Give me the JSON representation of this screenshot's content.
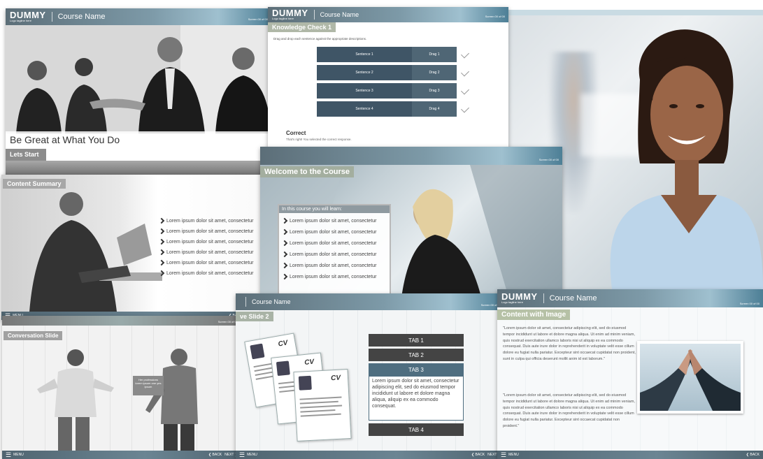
{
  "brand": {
    "logo": "DUMMY",
    "tagline": "Logo tagline here"
  },
  "course_name": "Course Name",
  "page_counter": "Screen 00 of 00",
  "footer": {
    "menu": "MENU",
    "back": "BACK",
    "next": "NEXT"
  },
  "slides": {
    "intro": {
      "title": "Be Great at What You Do",
      "button": "Lets Start"
    },
    "knowledge_check": {
      "title": "Knowledge Check 1",
      "instruction": "Drag and drop each sentence against the appropriate descriptions.",
      "rows": [
        {
          "sentence": "Sentence 1",
          "drag": "Drag 1"
        },
        {
          "sentence": "Sentence 2",
          "drag": "Drag 2"
        },
        {
          "sentence": "Sentence 3",
          "drag": "Drag 3"
        },
        {
          "sentence": "Sentence 4",
          "drag": "Drag 4"
        }
      ],
      "feedback_title": "Correct",
      "feedback_text": "That's right! You selected the correct response."
    },
    "summary": {
      "title": "Content Summary",
      "items": [
        "Lorem ipsum dolor sit amet, consectetur",
        "Lorem ipsum dolor sit amet, consectetur",
        "Lorem ipsum dolor sit amet, consectetur",
        "Lorem ipsum dolor sit amet, consectetur",
        "Lorem ipsum dolor sit amet, consectetur",
        "Lorem ipsum dolor sit amet, consectetur"
      ]
    },
    "welcome": {
      "title": "Welcome to the Course",
      "box_title": "In this course you will learn:",
      "items": [
        "Lorem ipsum dolor sit amet, consectetur",
        "Lorem ipsum dolor sit amet, consectetur",
        "Lorem ipsum dolor sit amet, consectetur",
        "Lorem ipsum dolor sit amet, consectetur",
        "Lorem ipsum dolor sit amet, consectetur",
        "Lorem ipsum dolor sit amet, consectetur"
      ]
    },
    "conversation": {
      "title": "Conversation Slide",
      "bubble": "Her professions lorem ipsum one yes ipsum"
    },
    "interactive": {
      "title": "ve Slide 2",
      "tabs": [
        "TAB 1",
        "TAB 2",
        "TAB 3",
        "TAB 4"
      ],
      "tab3_text": "Lorem ipsum dolor sit amet, consectetur adipiscing elit, sed do eiusmod tempor incididunt ut labore et dolore magna aliqua, aliquip ex ea commodo consequat.",
      "cv_label": "CV"
    },
    "content_image": {
      "title": "Content with Image",
      "para1": "\"Lorem ipsum dolor sit amet, consectetur adipiscing elit, sed do eiusmod tempor incididunt ut labore et dolore magna aliqua. Ut enim ad minim veniam, quis nostrud exercitation ullamco laboris nisi ut aliquip ex ea commodo consequat. Duis aute irure dolor in reprehenderit in voluptate velit esse cillum dolore eu fugiat nulla pariatur. Excepteur sint occaecat cupidatat non proident, sunt in culpa qui officia deserunt mollit anim id est laborum.\"",
      "para2": "\"Lorem ipsum dolor sit amet, consectetur adipiscing elit, sed do eiusmod tempor incididunt ut labore et dolore magna aliqua. Ut enim ad minim veniam, quis nostrud exercitation ullamco laboris nisi ut aliquip ex ea commodo consequat. Duis aute irure dolor in reprehenderit in voluptate velit esse cillum dolore eu fugiat nulla pariatur. Excepteur sint occaecat cupidatat non proident.\""
    }
  }
}
